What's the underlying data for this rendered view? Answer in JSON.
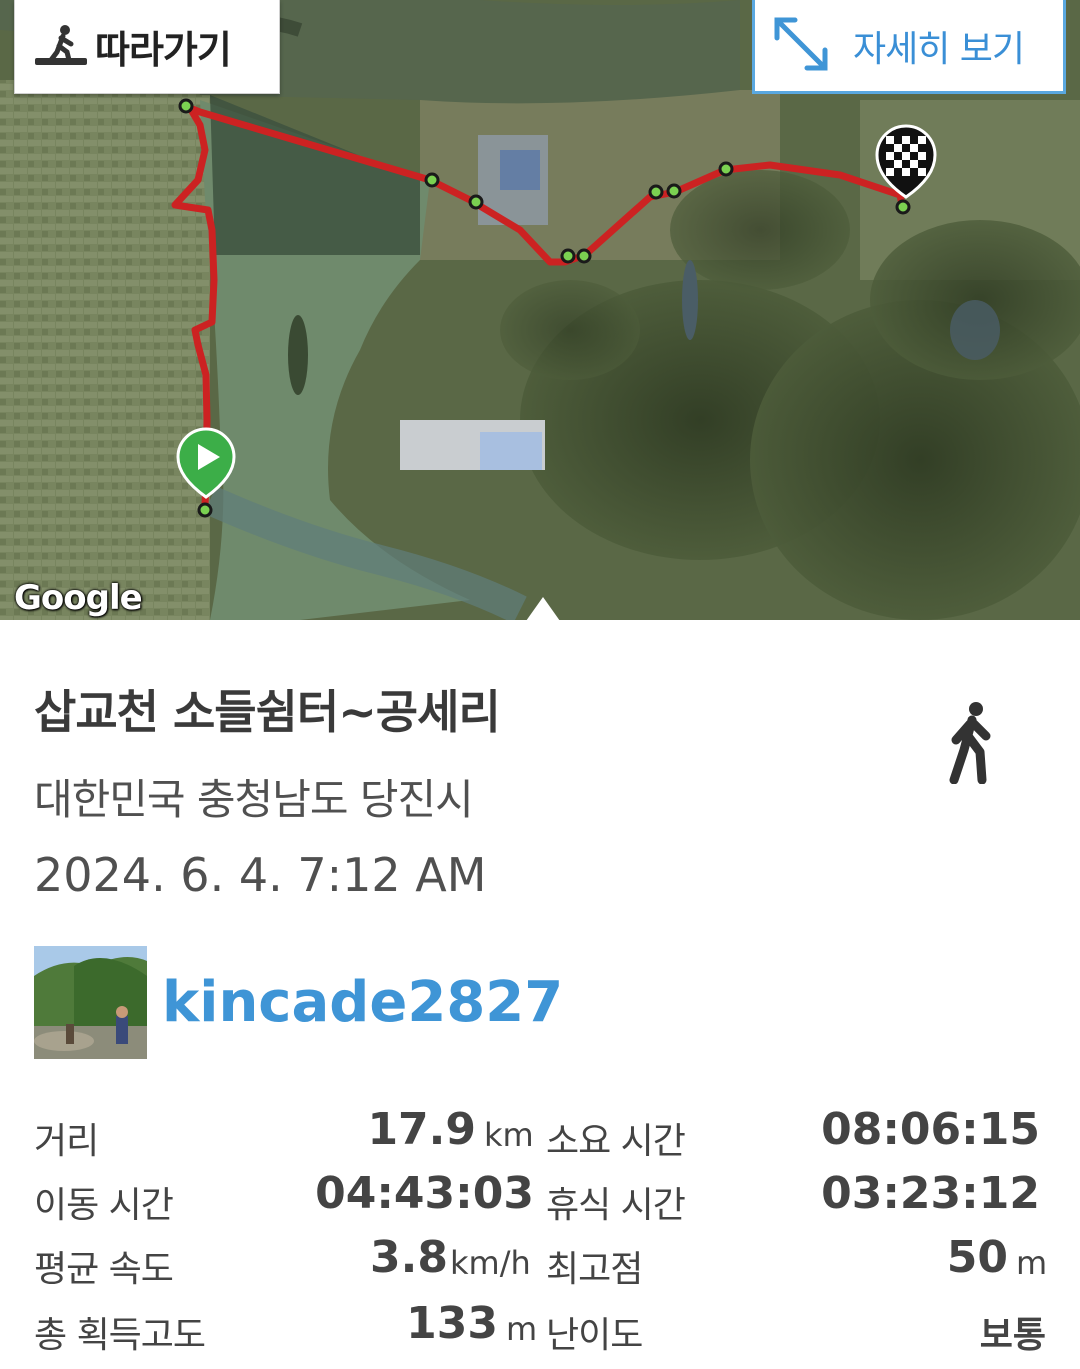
{
  "map": {
    "follow_label": "따라가기",
    "detail_label": "자세히 보기",
    "google_logo": "Google",
    "route_color": "#cc2222",
    "waypoint_color": "#7bd151",
    "start_icon": "play-marker-icon",
    "end_icon": "checkered-flag-icon"
  },
  "track": {
    "title": "삽교천 소들쉼터~공세리",
    "location": "대한민국 충청남도 당진시",
    "datetime": "2024. 6. 4. 7:12 AM",
    "activity_icon": "walking-person-icon",
    "user": "kincade2827"
  },
  "stats": [
    {
      "label": "거리",
      "value": "17.9",
      "unit": "km"
    },
    {
      "label": "소요 시간",
      "value": "08:06:15",
      "unit": ""
    },
    {
      "label": "이동 시간",
      "value": "04:43:03",
      "unit": ""
    },
    {
      "label": "휴식 시간",
      "value": "03:23:12",
      "unit": ""
    },
    {
      "label": "평균 속도",
      "value": "3.8",
      "unit": "km/h"
    },
    {
      "label": "최고점",
      "value": "50",
      "unit": "m"
    },
    {
      "label": "총 획득고도",
      "value": "133",
      "unit": "m"
    },
    {
      "label": "난이도",
      "value": "보통",
      "unit": ""
    }
  ],
  "colors": {
    "accent": "#3f95d6",
    "text": "#444444"
  }
}
